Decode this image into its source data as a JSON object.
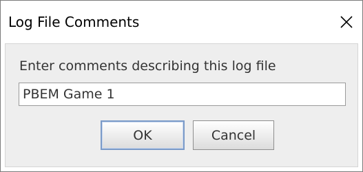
{
  "window": {
    "title": "Log File Comments"
  },
  "dialog": {
    "prompt": "Enter comments describing this log file",
    "comment_value": "PBEM Game 1",
    "ok_label": "OK",
    "cancel_label": "Cancel"
  },
  "icons": {
    "close": "close-icon"
  },
  "colors": {
    "content_background": "#eeeeee",
    "default_button_border": "#7a9ac8"
  }
}
